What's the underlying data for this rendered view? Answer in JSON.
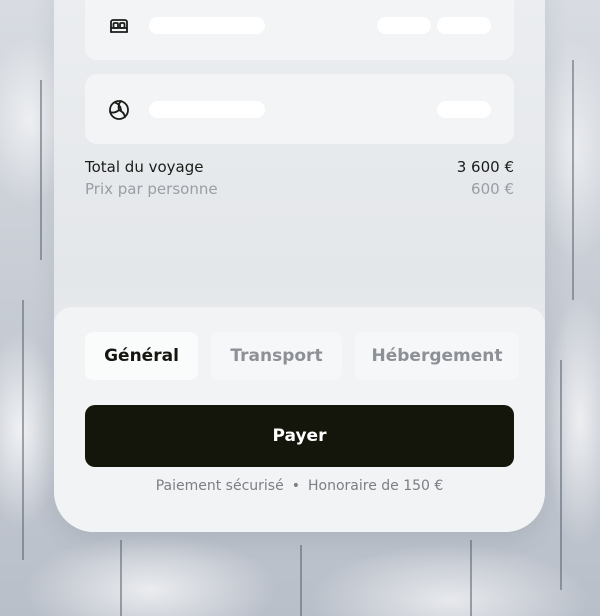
{
  "summary": {
    "total_label": "Total du voyage",
    "total_value": "3 600 €",
    "per_person_label": "Prix par personne",
    "per_person_value": "600 €"
  },
  "rows": [
    {
      "icon": "bed-icon"
    },
    {
      "icon": "volleyball-icon"
    }
  ],
  "tabs": [
    {
      "label": "Général",
      "active": true
    },
    {
      "label": "Transport",
      "active": false
    },
    {
      "label": "Hébergement",
      "active": false
    }
  ],
  "pay_button": {
    "label": "Payer"
  },
  "footer": {
    "secure": "Paiement sécurisé",
    "separator": "•",
    "fee": "Honoraire de 150 €"
  },
  "colors": {
    "primary": "#14160c",
    "muted": "#9a9da3"
  }
}
